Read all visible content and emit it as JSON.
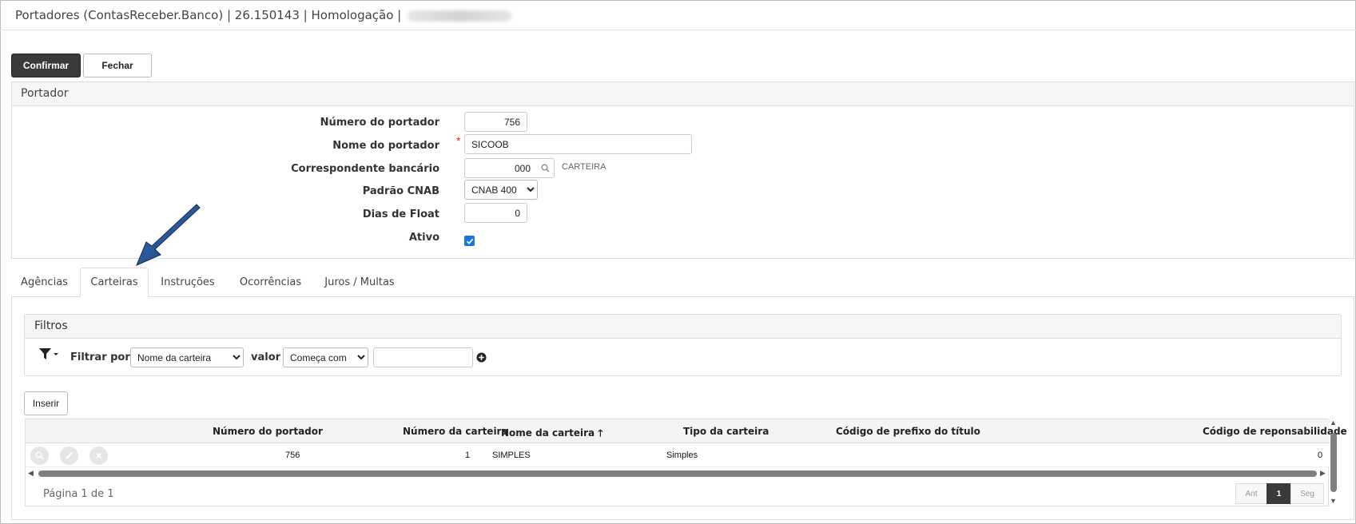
{
  "window": {
    "title": "Portadores (ContasReceber.Banco) | 26.150143 | Homologação |"
  },
  "toolbar": {
    "confirm_label": "Confirmar",
    "close_label": "Fechar"
  },
  "portador": {
    "section_title": "Portador",
    "numero_label": "Número do portador",
    "numero_value": "756",
    "nome_label": "Nome do portador",
    "nome_value": "SICOOB",
    "required_mark": "*",
    "correspondente_label": "Correspondente bancário",
    "correspondente_value": "000",
    "correspondente_desc": "CARTEIRA",
    "cnab_label": "Padrão CNAB",
    "cnab_value": "CNAB 400",
    "float_label": "Dias de Float",
    "float_value": "0",
    "ativo_label": "Ativo",
    "ativo_checked": true
  },
  "tabs": [
    {
      "label": "Agências",
      "active": false
    },
    {
      "label": "Carteiras",
      "active": true
    },
    {
      "label": "Instruções",
      "active": false
    },
    {
      "label": "Ocorrências",
      "active": false
    },
    {
      "label": "Juros / Multas",
      "active": false
    }
  ],
  "filters": {
    "title": "Filtros",
    "filter_by_label": "Filtrar por",
    "field_value": "Nome da carteira",
    "valor_label": "valor",
    "operator_value": "Começa com",
    "text_value": ""
  },
  "insert_label": "Inserir",
  "grid": {
    "columns": [
      "Número do portador",
      "Número da carteira",
      "Nome da carteira",
      "Tipo da carteira",
      "Código de prefixo do título",
      "Código de reponsabilidade"
    ],
    "sort_indicator": "🡑",
    "rows": [
      {
        "numero_portador": "756",
        "numero_carteira": "1",
        "nome_carteira": "SIMPLES",
        "tipo_carteira": "Simples",
        "codigo_prefixo": "",
        "codigo_responsabilidade": "0"
      }
    ]
  },
  "pager": {
    "text": "Página 1 de 1",
    "prev_label": "Ant",
    "current": "1",
    "next_label": "Seg"
  },
  "colors": {
    "primary_button": "#3a3a3a",
    "checkbox": "#1a73e8",
    "required": "#d9251c",
    "annotation_arrow": "#1f4e8c"
  }
}
